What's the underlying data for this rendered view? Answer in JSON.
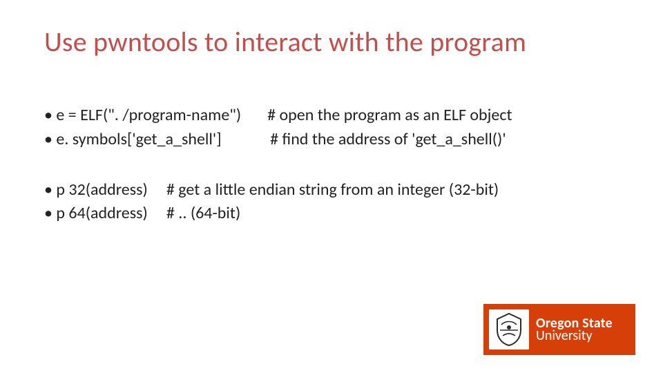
{
  "title": "Use pwntools to interact with the program",
  "bullets": {
    "b1": "• e = ELF(\". /program-name\")       # open the program as an ELF object",
    "b2": "• e. symbols['get_a_shell']             # find the address of 'get_a_shell()'",
    "b3": "• p 32(address)     # get a little endian string from an integer (32-bit)",
    "b4": "• p 64(address)     # .. (64-bit)"
  },
  "logo": {
    "line1": "Oregon State",
    "line2": "University"
  }
}
